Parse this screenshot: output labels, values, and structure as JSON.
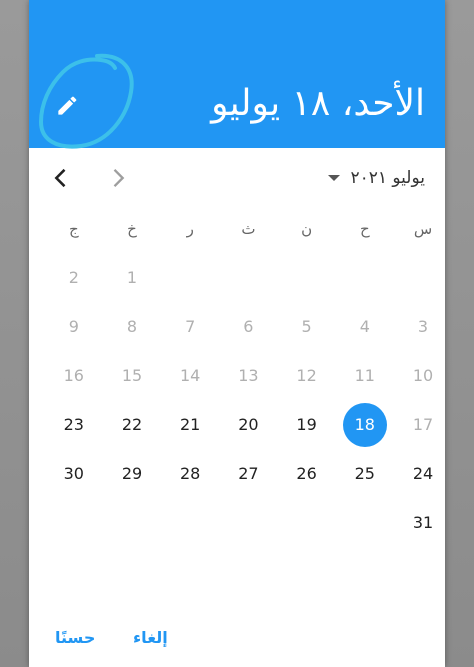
{
  "colors": {
    "accent": "#2196f3",
    "annotation": "#3cc0ea"
  },
  "header": {
    "selected_date": "الأحد، ١٨ يوليو",
    "edit_icon": "pencil-icon"
  },
  "navigation": {
    "month_label": "يوليو ٢٠٢١",
    "prev_icon": "chevron-left-icon",
    "next_icon": "chevron-right-icon"
  },
  "weekdays": [
    "س",
    "ح",
    "ن",
    "ث",
    "ر",
    "خ",
    "ج"
  ],
  "calendar": {
    "selected_day": 18,
    "weeks": [
      [
        null,
        null,
        null,
        null,
        null,
        {
          "d": 1,
          "enabled": false
        },
        {
          "d": 2,
          "enabled": false
        }
      ],
      [
        {
          "d": 3,
          "enabled": false
        },
        {
          "d": 4,
          "enabled": false
        },
        {
          "d": 5,
          "enabled": false
        },
        {
          "d": 6,
          "enabled": false
        },
        {
          "d": 7,
          "enabled": false
        },
        {
          "d": 8,
          "enabled": false
        },
        {
          "d": 9,
          "enabled": false
        }
      ],
      [
        {
          "d": 10,
          "enabled": false
        },
        {
          "d": 11,
          "enabled": false
        },
        {
          "d": 12,
          "enabled": false
        },
        {
          "d": 13,
          "enabled": false
        },
        {
          "d": 14,
          "enabled": false
        },
        {
          "d": 15,
          "enabled": false
        },
        {
          "d": 16,
          "enabled": false
        }
      ],
      [
        {
          "d": 17,
          "enabled": false
        },
        {
          "d": 18,
          "enabled": true
        },
        {
          "d": 19,
          "enabled": true
        },
        {
          "d": 20,
          "enabled": true
        },
        {
          "d": 21,
          "enabled": true
        },
        {
          "d": 22,
          "enabled": true
        },
        {
          "d": 23,
          "enabled": true
        }
      ],
      [
        {
          "d": 24,
          "enabled": true
        },
        {
          "d": 25,
          "enabled": true
        },
        {
          "d": 26,
          "enabled": true
        },
        {
          "d": 27,
          "enabled": true
        },
        {
          "d": 28,
          "enabled": true
        },
        {
          "d": 29,
          "enabled": true
        },
        {
          "d": 30,
          "enabled": true
        }
      ],
      [
        {
          "d": 31,
          "enabled": true
        },
        null,
        null,
        null,
        null,
        null,
        null
      ]
    ]
  },
  "actions": {
    "cancel_label": "إلغاء",
    "ok_label": "حسنًا"
  }
}
